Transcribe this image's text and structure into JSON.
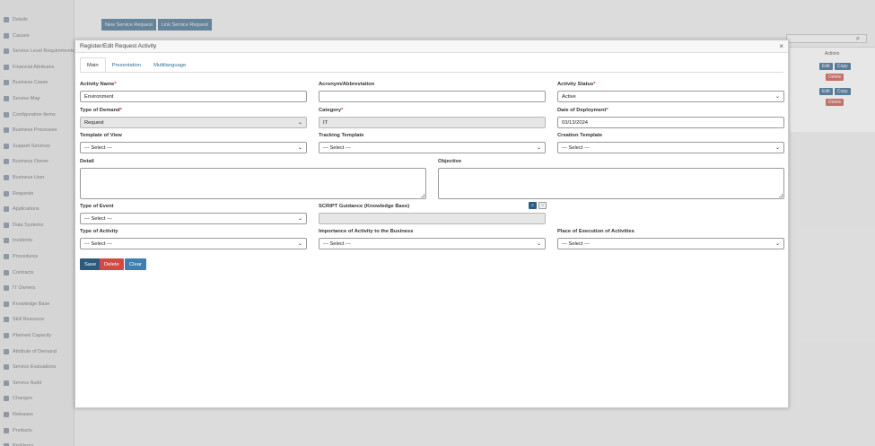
{
  "sidebar": {
    "items": [
      "Details",
      "Causes",
      "Service Level Requirements",
      "Financial Attributes",
      "Business Cases",
      "Service Map",
      "Configuration Items",
      "Business Processes",
      "Support Services",
      "Business Owner",
      "Business User",
      "Requests",
      "Applications",
      "Data Systems",
      "Incidents",
      "Procedures",
      "Contracts",
      "IT Owners",
      "Knowledge Base",
      "Skill Resource",
      "Planned Capacity",
      "Attribute of Demand",
      "Service Evaluations",
      "Service Audit",
      "Changes",
      "Releases",
      "Products",
      "Problems"
    ]
  },
  "background": {
    "new_request_label": "New Service Request",
    "link_request_label": "Link Service Request",
    "actions_header": "Actions",
    "edit_label": "Edit",
    "copy_label": "Copy",
    "delete_label": "Delete"
  },
  "modal": {
    "title": "Register/Edit Request Activity",
    "close": "×",
    "tabs": [
      "Main",
      "Presentation",
      "Multilanguage"
    ],
    "fields": {
      "activity_name": {
        "label": "Activity Name",
        "value": "Environment"
      },
      "acronym": {
        "label": "Acronym/Abbreviation",
        "value": ""
      },
      "activity_status": {
        "label": "Activity Status",
        "value": "Active"
      },
      "type_of_demand": {
        "label": "Type of Demand",
        "value": "Request"
      },
      "category": {
        "label": "Category",
        "value": "IT"
      },
      "date_of_deployment": {
        "label": "Date of Deployment",
        "value": "03/13/2024"
      },
      "template_of_view": {
        "label": "Template of View",
        "value": "--- Select ---"
      },
      "tracking_template": {
        "label": "Tracking Template",
        "value": "--- Select ---"
      },
      "creation_template": {
        "label": "Creation Template",
        "value": "--- Select ---"
      },
      "detail": {
        "label": "Detail"
      },
      "objective": {
        "label": "Objective"
      },
      "type_of_event": {
        "label": "Type of Event",
        "value": "--- Select ---"
      },
      "script_guidance": {
        "label": "SCRIPT Guidance (Knowledge Base)",
        "value": ""
      },
      "type_of_activity": {
        "label": "Type of Activity",
        "value": "--- Select ---"
      },
      "importance": {
        "label": "Importance of Activity to the Business",
        "value": "--- Select ---"
      },
      "place_of_execution": {
        "label": "Place of Execution of Activities",
        "value": "--- Select ---"
      }
    },
    "required_mark": "*",
    "chevron": "⌄",
    "buttons": {
      "save": "Save",
      "delete": "Delete",
      "clear": "Clear"
    }
  }
}
